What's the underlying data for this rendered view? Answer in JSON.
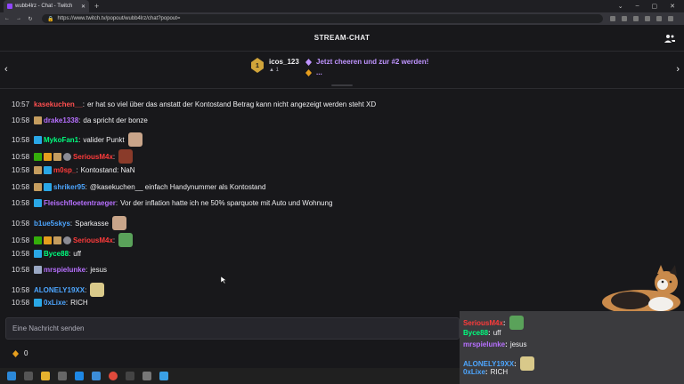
{
  "browser": {
    "tab_title": "wubb4lrz - Chat - Twitch",
    "url": "https://www.twitch.tv/popout/wubb4lrz/chat?popout="
  },
  "header": {
    "title": "STREAM-CHAT"
  },
  "leaderboard": {
    "top_user": "icos_123",
    "top_bits": "1",
    "cheer_text": "Jetzt cheeren und zur #2 werden!",
    "cheer_more": "..."
  },
  "colors": {
    "accent": "#9147ff",
    "cheer": "#bf94ff",
    "background": "#18181b"
  },
  "messages": [
    {
      "time": "10:57",
      "user": "kasekuchen__",
      "color": "#ff4f4f",
      "text": "er hat so viel über das anstatt der Kontostand Betrag kann nicht angezeigt werden steht XD",
      "badges": [],
      "emote": ""
    },
    {
      "time": "10:58",
      "user": "drake1338",
      "color": "#b770ff",
      "text": "da spricht der bonze",
      "badges": [
        "gold"
      ],
      "emote": ""
    },
    {
      "time": "10:58",
      "user": "MykoFan1",
      "color": "#00ff7f",
      "text": "valider Punkt",
      "badges": [
        "blue"
      ],
      "emote": "face-emote"
    },
    {
      "time": "10:58",
      "user": "SeriousM4x",
      "color": "#ff3b3b",
      "text": "",
      "badges": [
        "green",
        "orange",
        "gold",
        "grey"
      ],
      "emote": "image-emote"
    },
    {
      "time": "10:58",
      "user": "m0sp_",
      "color": "#ff3b3b",
      "text": "Kontostand: NaN",
      "badges": [
        "gold",
        "blue"
      ],
      "emote": ""
    },
    {
      "time": "10:58",
      "user": "shriker95",
      "color": "#4da6ff",
      "text": "@kasekuchen__ einfach Handynummer als Kontostand",
      "badges": [
        "gold",
        "blue"
      ],
      "emote": ""
    },
    {
      "time": "10:58",
      "user": "Fleischfloetentraeger",
      "color": "#b770ff",
      "text": "Vor der inflation hatte ich ne 50% sparquote mit Auto und Wohnung",
      "badges": [
        "blue"
      ],
      "emote": ""
    },
    {
      "time": "10:58",
      "user": "b1ue5skys",
      "color": "#4da6ff",
      "text": "Sparkasse",
      "badges": [],
      "emote": "face-emote"
    },
    {
      "time": "10:58",
      "user": "SeriousM4x",
      "color": "#ff3b3b",
      "text": "",
      "badges": [
        "green",
        "orange",
        "gold",
        "grey"
      ],
      "emote": "frog-emote"
    },
    {
      "time": "10:58",
      "user": "Byce88",
      "color": "#00ff7f",
      "text": "uff",
      "badges": [
        "blue"
      ],
      "emote": ""
    },
    {
      "time": "10:58",
      "user": "mrspielunke",
      "color": "#b770ff",
      "text": "jesus",
      "badges": [
        "pink"
      ],
      "emote": ""
    },
    {
      "time": "10:58",
      "user": "ALONELY19XX",
      "color": "#4da6ff",
      "text": "",
      "badges": [],
      "emote": "cake-emote"
    },
    {
      "time": "10:58",
      "user": "0xLixe",
      "color": "#4da6ff",
      "text": "RICH",
      "badges": [
        "blue"
      ],
      "emote": ""
    }
  ],
  "input": {
    "placeholder": "Eine Nachricht senden"
  },
  "channel_points": {
    "value": "0"
  },
  "overlay": [
    {
      "user": "SeriousM4x",
      "color": "#ff3b3b",
      "text": ""
    },
    {
      "user": "Byce88",
      "color": "#00ff7f",
      "text": "uff"
    },
    {
      "user": "mrspielunke",
      "color": "#b770ff",
      "text": "jesus"
    },
    {
      "user": "ALONELY19XX",
      "color": "#4da6ff",
      "text": ""
    },
    {
      "user": "0xLixe",
      "color": "#4da6ff",
      "text": "RICH"
    }
  ]
}
